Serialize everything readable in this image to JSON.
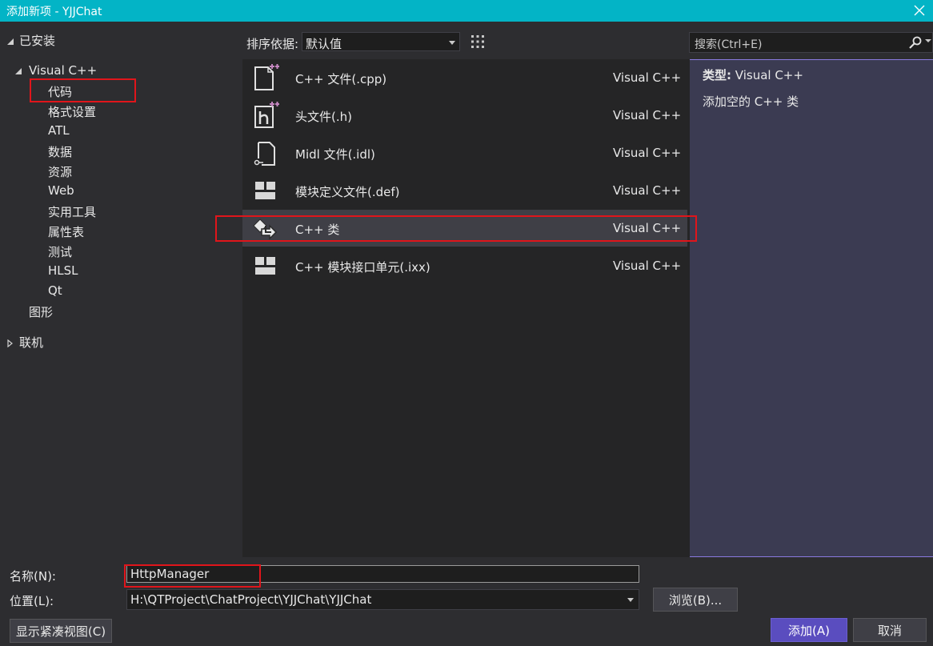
{
  "window": {
    "title": "添加新项 - YJJChat"
  },
  "tree": {
    "installed": "已安装",
    "visual_cpp": "Visual C++",
    "children": [
      "代码",
      "格式设置",
      "ATL",
      "数据",
      "资源",
      "Web",
      "实用工具",
      "属性表",
      "测试",
      "HLSL",
      "Qt"
    ],
    "graphics": "图形",
    "online": "联机"
  },
  "toolbar": {
    "sort_label": "排序依据:",
    "sort_value": "默认值",
    "search_placeholder": "搜索(Ctrl+E)"
  },
  "templates": [
    {
      "name": "C++ 文件(.cpp)",
      "lang": "Visual C++",
      "icon": "cpp-file-icon"
    },
    {
      "name": "头文件(.h)",
      "lang": "Visual C++",
      "icon": "header-file-icon"
    },
    {
      "name": "Midl 文件(.idl)",
      "lang": "Visual C++",
      "icon": "midl-file-icon"
    },
    {
      "name": "模块定义文件(.def)",
      "lang": "Visual C++",
      "icon": "module-def-icon"
    },
    {
      "name": "C++ 类",
      "lang": "Visual C++",
      "icon": "cpp-class-icon",
      "selected": true
    },
    {
      "name": "C++ 模块接口单元(.ixx)",
      "lang": "Visual C++",
      "icon": "module-interface-icon"
    }
  ],
  "details": {
    "type_label": "类型:",
    "type_value": "Visual C++",
    "description": "添加空的 C++ 类"
  },
  "form": {
    "name_label": "名称(N):",
    "name_value": "HttpManager",
    "location_label": "位置(L):",
    "location_value": "H:\\QTProject\\ChatProject\\YJJChat\\YJJChat"
  },
  "buttons": {
    "browse": "浏览(B)...",
    "compact": "显示紧凑视图(C)",
    "add": "添加(A)",
    "cancel": "取消"
  },
  "colors": {
    "titlebar": "#03b4c6",
    "highlight": "#e0151b",
    "accent": "#5a4dbf",
    "icon_plus": "#c586c0"
  }
}
